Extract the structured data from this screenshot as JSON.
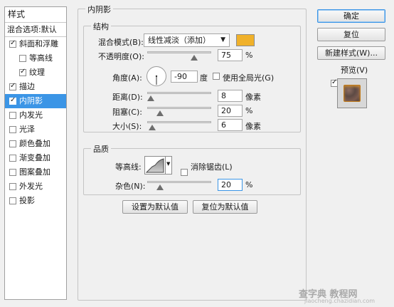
{
  "styles_panel": {
    "header": "样式",
    "blend_options": "混合选项:默认",
    "items": [
      {
        "label": "斜面和浮雕",
        "checked": true
      },
      {
        "label": "等高线",
        "checked": false
      },
      {
        "label": "纹理",
        "checked": true
      },
      {
        "label": "描边",
        "checked": true
      },
      {
        "label": "内阴影",
        "checked": true,
        "selected": true
      },
      {
        "label": "内发光",
        "checked": false
      },
      {
        "label": "光泽",
        "checked": false
      },
      {
        "label": "颜色叠加",
        "checked": false
      },
      {
        "label": "渐变叠加",
        "checked": false
      },
      {
        "label": "图案叠加",
        "checked": false
      },
      {
        "label": "外发光",
        "checked": false
      },
      {
        "label": "投影",
        "checked": false
      }
    ]
  },
  "inner_shadow": {
    "title": "内阴影",
    "structure": {
      "title": "结构",
      "blend_mode_label": "混合模式(B):",
      "blend_mode_value": "线性减淡（添加）",
      "swatch_color": "#f0b12a",
      "opacity_label": "不透明度(O):",
      "opacity_value": "75",
      "opacity_unit": "%",
      "opacity_percent": 75,
      "angle_label": "角度(A):",
      "angle_value": "-90",
      "angle_unit": "度",
      "global_light_label": "使用全局光(G)",
      "global_light_checked": false,
      "distance_label": "距离(D):",
      "distance_value": "8",
      "distance_unit": "像素",
      "choke_label": "阻塞(C):",
      "choke_value": "20",
      "choke_unit": "%",
      "size_label": "大小(S):",
      "size_value": "6",
      "size_unit": "像素"
    },
    "quality": {
      "title": "品质",
      "contour_label": "等高线:",
      "anti_alias_label": "消除锯齿(L)",
      "anti_alias_checked": false,
      "noise_label": "杂色(N):",
      "noise_value": "20",
      "noise_unit": "%"
    },
    "set_default_label": "设置为默认值",
    "reset_default_label": "复位为默认值"
  },
  "actions": {
    "ok_label": "确定",
    "reset_label": "复位",
    "new_style_label": "新建样式(W)...",
    "preview_label": "预览(V)",
    "preview_checked": true
  },
  "watermark": {
    "line1": "查字典 教程网",
    "line2": "jiaocheng.chazidian.com"
  },
  "colors": {
    "selection": "#3b95e6",
    "swatch": "#f0b12a"
  }
}
